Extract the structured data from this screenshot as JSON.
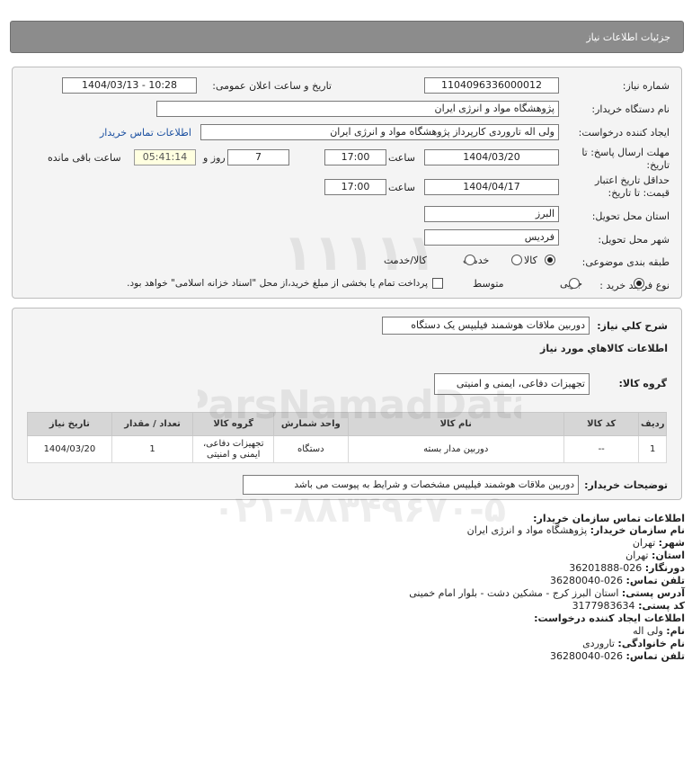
{
  "header": {
    "title": "جزئیات اطلاعات نیاز"
  },
  "form": {
    "need_number": {
      "label": "شماره نیاز:",
      "value": "1104096336000012"
    },
    "announce_datetime": {
      "label": "تاریخ و ساعت اعلان عمومی:",
      "value": "1404/03/13 - 10:28"
    },
    "buyer_org": {
      "label": "نام دستگاه خریدار:",
      "value": "پژوهشگاه مواد و انرژی ایران"
    },
    "requester": {
      "label": "ایجاد کننده درخواست:",
      "value": "ولی اله تاروردی کارپرداز پژوهشگاه مواد و انرژی ایران",
      "contact_link": "اطلاعات تماس خریدار"
    },
    "response_deadline": {
      "label_line1": "مهلت ارسال پاسخ: تا",
      "label_line2": "تاریخ:",
      "date": "1404/03/20",
      "time_label": "ساعت",
      "time": "17:00",
      "days": "7",
      "days_label": "روز و",
      "remaining": "05:41:14",
      "remaining_label": "ساعت باقی مانده"
    },
    "price_validity": {
      "label_line1": "حداقل تاریخ اعتبار",
      "label_line2": "قیمت: تا تاریخ:",
      "date": "1404/04/17",
      "time_label": "ساعت",
      "time": "17:00"
    },
    "province": {
      "label": "استان محل تحویل:",
      "value": "البرز"
    },
    "city": {
      "label": "شهر محل تحویل:",
      "value": "فردیس"
    },
    "category": {
      "label": "طبقه بندی موضوعی:",
      "options": [
        "کالا",
        "خدمت",
        "کالا/خدمت"
      ],
      "selected": "کالا"
    },
    "process": {
      "label": "نوع فرآیند خرید :",
      "options": [
        "جزیی",
        "متوسط"
      ],
      "selected": "جزیی",
      "treasury_note": "پرداخت تمام یا بخشی از مبلغ خرید،از محل \"اسناد خزانه اسلامی\" خواهد بود."
    }
  },
  "description": {
    "general_label": "شرح کلي نياز:",
    "general_value": "دوربین ملاقات هوشمند فیلیپس یک دستگاه",
    "items_title": "اطلاعات کالاهاي مورد نياز",
    "group_label": "گروه کالا:",
    "group_value": "تجهیزات دفاعی، ایمنی و امنیتی",
    "table": {
      "headers": [
        "ردیف",
        "کد کالا",
        "نام کالا",
        "واحد شمارش",
        "گروه کالا",
        "تعداد / مقدار",
        "تاریخ نیاز"
      ],
      "rows": [
        [
          "1",
          "--",
          "دوربین مدار بسته",
          "دستگاه",
          "تجهیزات دفاعی، ایمنی و امنیتی",
          "1",
          "1404/03/20"
        ]
      ]
    },
    "buyer_notes_label": "توضیحات خریدار:",
    "buyer_notes_value": "دوربین ملاقات هوشمند فیلیپس مشخصات و شرایط به پیوست می باشد"
  },
  "contact": {
    "title": "اطلاعات تماس سازمان خریدار:",
    "lines": [
      {
        "k": "نام سازمان خریدار:",
        "v": "پژوهشگاه مواد و انرژی ایران"
      },
      {
        "k": "شهر:",
        "v": "تهران"
      },
      {
        "k": "استان:",
        "v": "تهران"
      },
      {
        "k": "دورنگار:",
        "v": "026-36201888"
      },
      {
        "k": "تلفن تماس:",
        "v": "026-36280040"
      },
      {
        "k": "آدرس پستی:",
        "v": "استان البرز کرج - مشکین دشت - بلوار امام خمینی"
      },
      {
        "k": "کد پستی:",
        "v": "3177983634"
      }
    ],
    "requester_title": "اطلاعات ایجاد کننده درخواست:",
    "requester_lines": [
      {
        "k": "نام:",
        "v": "ولی اله"
      },
      {
        "k": "نام خانوادگی:",
        "v": "تاروردی"
      },
      {
        "k": "تلفن تماس:",
        "v": "026-36280040"
      }
    ]
  },
  "watermark": {
    "brand": "ParsNamadData",
    "phone": "۰۲۱-۸۸۳۴۹۶۷۰-۵",
    "number": "۱۱۱۱۱"
  },
  "colors": {
    "header_bg": "#8c8c8c",
    "panel_bg": "#f4f4f4",
    "link": "#1a4fa0",
    "table_header": "#d6d6d6"
  }
}
